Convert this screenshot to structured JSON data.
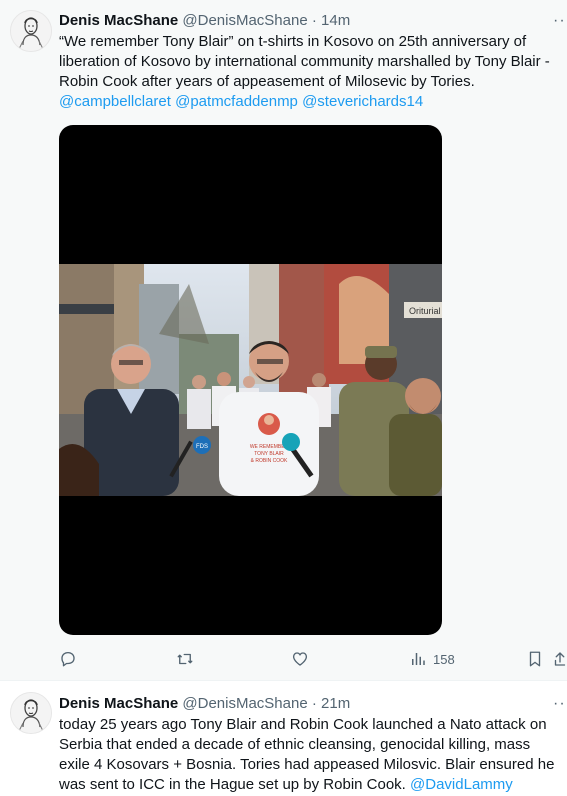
{
  "colors": {
    "accent": "#1d9bf0",
    "text": "#0f1419",
    "muted": "#536471",
    "highlight_bg": "#f7f9f9"
  },
  "tweets": [
    {
      "author_name": "Denis MacShane",
      "handle": "@DenisMacShane",
      "separator": "·",
      "time": "14m",
      "text_lines": [
        "“We remember Tony Blair” on t-shirts in Kosovo on 25th anniversary of",
        "liberation of Kosovo  by international community marshalled by Tony Blair -",
        "Robin Cook after years of appeasement of Milosevic by Tories."
      ],
      "mentions": [
        "@campbellclaret",
        "@patmcfaddenmp",
        "@steverichards14"
      ],
      "media": {
        "description_icon": "photo",
        "shirt_text": [
          "WE REMEMBER",
          "TONY BLAIR",
          "& ROBIN COOK"
        ],
        "sign_text": "Oriturial",
        "mic_text": "FDS"
      },
      "actions": {
        "reply_icon": "reply-icon",
        "retweet_icon": "retweet-icon",
        "like_icon": "like-icon",
        "views_icon": "views-icon",
        "views_count": "158",
        "bookmark_icon": "bookmark-icon",
        "share_icon": "share-icon"
      }
    },
    {
      "author_name": "Denis MacShane",
      "handle": "@DenisMacShane",
      "separator": "·",
      "time": "21m",
      "text_lines": [
        "today 25 years ago Tony Blair and Robin Cook launched a Nato attack on",
        "Serbia that ended a decade of ethnic cleansing, genocidal killing, mass",
        "exile 4 Kosovars + Bosnia. Tories had appeased Milosvic. Blair ensured he",
        "was sent to ICC in the Hague set up by Robin Cook."
      ],
      "mention": "@DavidLammy"
    }
  ]
}
